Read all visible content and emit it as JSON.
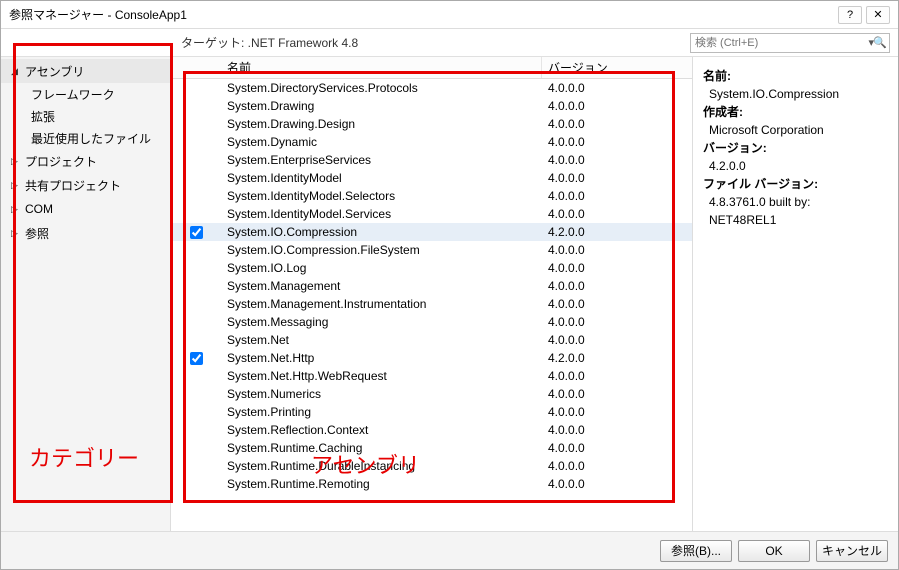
{
  "title": "参照マネージャー - ConsoleApp1",
  "target": "ターゲット: .NET Framework 4.8",
  "search_placeholder": "検索 (Ctrl+E)",
  "sidebar": {
    "assemblies": {
      "label": "アセンブリ",
      "expanded": true,
      "subs": [
        "フレームワーク",
        "拡張",
        "最近使用したファイル"
      ]
    },
    "projects": {
      "label": "プロジェクト"
    },
    "shared": {
      "label": "共有プロジェクト"
    },
    "com": {
      "label": "COM"
    },
    "browse": {
      "label": "参照"
    }
  },
  "columns": {
    "name": "名前",
    "version": "バージョン"
  },
  "rows": [
    {
      "name": "System.DirectoryServices.Protocols",
      "ver": "4.0.0.0"
    },
    {
      "name": "System.Drawing",
      "ver": "4.0.0.0"
    },
    {
      "name": "System.Drawing.Design",
      "ver": "4.0.0.0"
    },
    {
      "name": "System.Dynamic",
      "ver": "4.0.0.0"
    },
    {
      "name": "System.EnterpriseServices",
      "ver": "4.0.0.0"
    },
    {
      "name": "System.IdentityModel",
      "ver": "4.0.0.0"
    },
    {
      "name": "System.IdentityModel.Selectors",
      "ver": "4.0.0.0"
    },
    {
      "name": "System.IdentityModel.Services",
      "ver": "4.0.0.0"
    },
    {
      "name": "System.IO.Compression",
      "ver": "4.2.0.0",
      "checked": true,
      "selected": true
    },
    {
      "name": "System.IO.Compression.FileSystem",
      "ver": "4.0.0.0"
    },
    {
      "name": "System.IO.Log",
      "ver": "4.0.0.0"
    },
    {
      "name": "System.Management",
      "ver": "4.0.0.0"
    },
    {
      "name": "System.Management.Instrumentation",
      "ver": "4.0.0.0"
    },
    {
      "name": "System.Messaging",
      "ver": "4.0.0.0"
    },
    {
      "name": "System.Net",
      "ver": "4.0.0.0"
    },
    {
      "name": "System.Net.Http",
      "ver": "4.2.0.0",
      "checked": true
    },
    {
      "name": "System.Net.Http.WebRequest",
      "ver": "4.0.0.0"
    },
    {
      "name": "System.Numerics",
      "ver": "4.0.0.0"
    },
    {
      "name": "System.Printing",
      "ver": "4.0.0.0"
    },
    {
      "name": "System.Reflection.Context",
      "ver": "4.0.0.0"
    },
    {
      "name": "System.Runtime.Caching",
      "ver": "4.0.0.0"
    },
    {
      "name": "System.Runtime.DurableInstancing",
      "ver": "4.0.0.0"
    },
    {
      "name": "System.Runtime.Remoting",
      "ver": "4.0.0.0"
    }
  ],
  "detail": {
    "name_label": "名前:",
    "name_value": "System.IO.Compression",
    "author_label": "作成者:",
    "author_value": "Microsoft Corporation",
    "version_label": "バージョン:",
    "version_value": "4.2.0.0",
    "filever_label": "ファイル バージョン:",
    "filever_line1": "4.8.3761.0 built by:",
    "filever_line2": "NET48REL1"
  },
  "buttons": {
    "browse": "参照(B)...",
    "ok": "OK",
    "cancel": "キャンセル"
  },
  "annotations": {
    "category": "カテゴリー",
    "assembly": "アセンブリ"
  }
}
